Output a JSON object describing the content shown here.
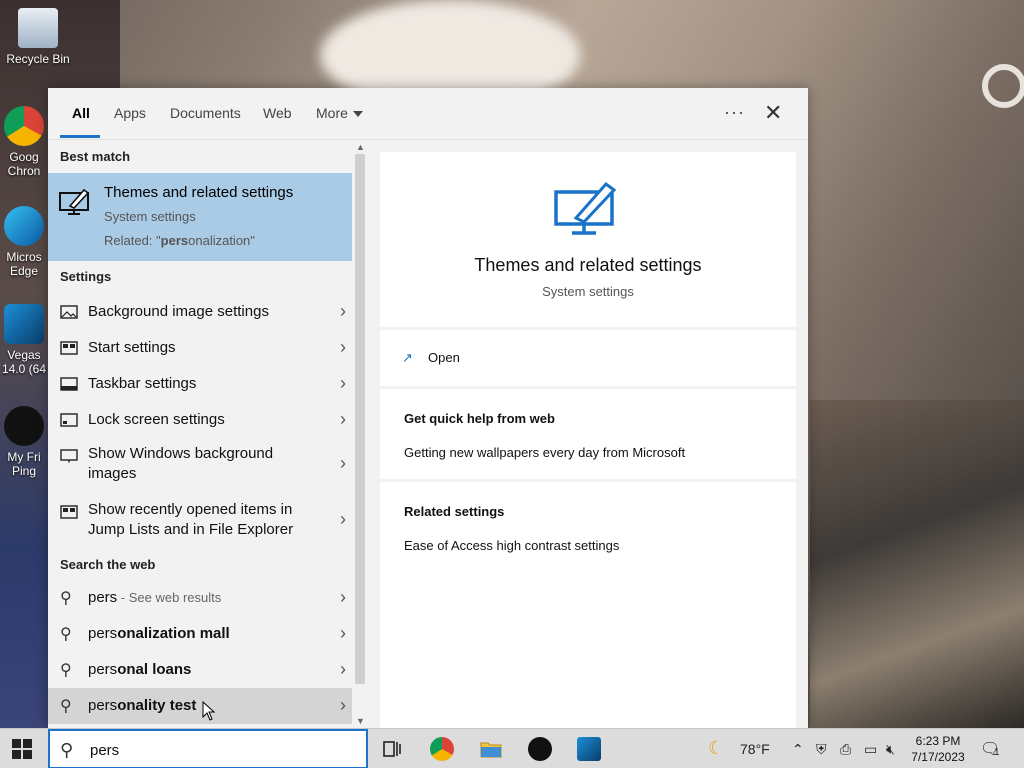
{
  "desktop": {
    "icons": [
      {
        "label": "Recycle Bin"
      },
      {
        "label": "Goog Chron"
      },
      {
        "label": "Micros Edge"
      },
      {
        "label": "Vegas 14.0 (64"
      },
      {
        "label": "My Fri Ping"
      }
    ]
  },
  "tabs": [
    {
      "label": "All",
      "active": true
    },
    {
      "label": "Apps"
    },
    {
      "label": "Documents"
    },
    {
      "label": "Web"
    },
    {
      "label": "More"
    }
  ],
  "header": {
    "more_icon": "ellipsis-icon",
    "close_icon": "close-icon"
  },
  "list": {
    "best_match_header": "Best match",
    "best_match": {
      "title": "Themes and related settings",
      "subtitle": "System settings",
      "related_prefix": "Related: \"",
      "related_bold": "pers",
      "related_rest": "onalization\""
    },
    "settings_header": "Settings",
    "settings": [
      {
        "label": "Background image settings",
        "icon": "picture-icon"
      },
      {
        "label": "Start settings",
        "icon": "start-icon"
      },
      {
        "label": "Taskbar settings",
        "icon": "taskbar-icon"
      },
      {
        "label": "Lock screen settings",
        "icon": "lock-screen-icon"
      },
      {
        "label": "Show Windows background images",
        "icon": "monitor-icon"
      },
      {
        "label": "Show recently opened items in Jump Lists and in File Explorer",
        "icon": "start-icon"
      }
    ],
    "web_header": "Search the web",
    "web": [
      {
        "query": "pers",
        "suffix": "onalization mall",
        "note": " - See web results"
      },
      {
        "query": "pers",
        "suffix": "onalization mall"
      },
      {
        "query": "pers",
        "suffix": "onal loans"
      },
      {
        "query": "pers",
        "suffix": "onality test"
      }
    ]
  },
  "detail": {
    "title": "Themes and related settings",
    "subtitle": "System settings",
    "open_label": "Open",
    "quick_help_header": "Get quick help from web",
    "quick_help_link": "Getting new wallpapers every day from Microsoft",
    "related_header": "Related settings",
    "related_link": "Ease of Access high contrast settings"
  },
  "taskbar": {
    "search_value": "pers",
    "weather": "78°F",
    "time": "6:23 PM",
    "date": "7/17/2023",
    "notification_count": "1"
  },
  "colors": {
    "accent": "#1a73c9",
    "selected": "#aacbe6"
  }
}
